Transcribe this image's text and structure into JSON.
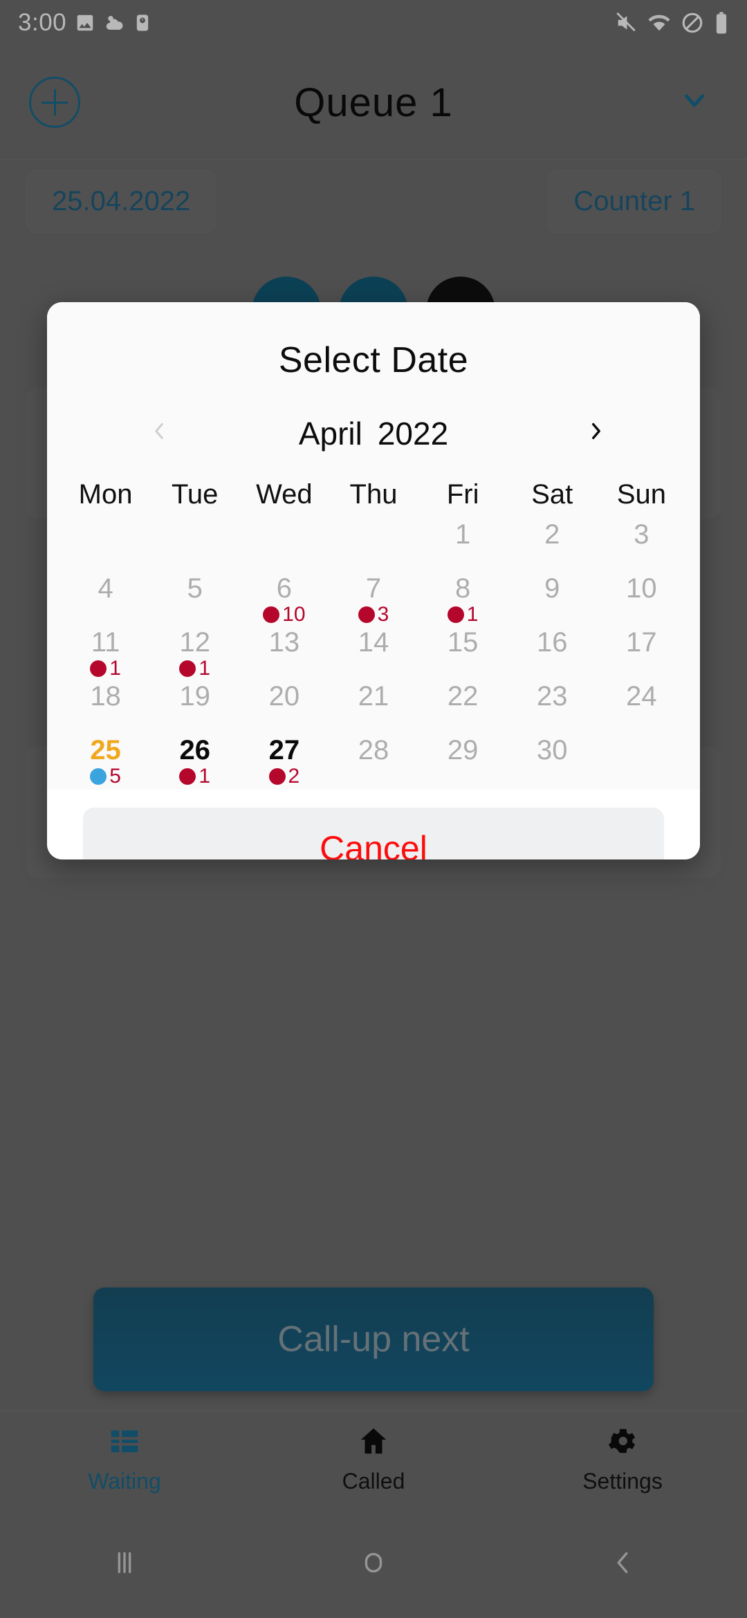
{
  "status_bar": {
    "time": "3:00",
    "left_icons": [
      "image-icon",
      "weather-icon",
      "alarm-clock-icon"
    ],
    "right_icons": [
      "mute-icon",
      "wifi-icon",
      "do-not-disturb-icon",
      "battery-icon"
    ]
  },
  "app_bar": {
    "add_icon": "plus-circle-icon",
    "title": "Queue 1",
    "dropdown_icon": "chevron-down-icon",
    "accent_color": "#1a6b8f"
  },
  "filters": {
    "date_chip": "25.04.2022",
    "counter_chip": "Counter 1"
  },
  "primary_action": {
    "label": "Call-up next"
  },
  "bottom_nav": {
    "items": [
      {
        "label": "Waiting",
        "icon": "list-icon",
        "active": true
      },
      {
        "label": "Called",
        "icon": "home-icon",
        "active": false
      },
      {
        "label": "Settings",
        "icon": "gear-icon",
        "active": false
      }
    ]
  },
  "system_nav": {
    "recents_icon": "recents-icon",
    "home_icon": "home-circle-icon",
    "back_icon": "back-chevron-icon"
  },
  "dialog": {
    "title": "Select Date",
    "prev_icon": "chevron-left-icon",
    "next_icon": "chevron-right-icon",
    "prev_enabled": false,
    "next_enabled": true,
    "month": "April",
    "year": "2022",
    "weekdays": [
      "Mon",
      "Tue",
      "Wed",
      "Thu",
      "Fri",
      "Sat",
      "Sun"
    ],
    "cancel_label": "Cancel",
    "colors": {
      "selected_day": "#f0a81e",
      "badge_red": "#b5062c",
      "badge_blue": "#3ba3de",
      "cancel_text": "#fc0d0d"
    },
    "weeks": [
      [
        {
          "day": "",
          "state": "blank",
          "badge": null
        },
        {
          "day": "",
          "state": "blank",
          "badge": null
        },
        {
          "day": "",
          "state": "blank",
          "badge": null
        },
        {
          "day": "",
          "state": "blank",
          "badge": null
        },
        {
          "day": "1",
          "state": "normal",
          "badge": null
        },
        {
          "day": "2",
          "state": "normal",
          "badge": null
        },
        {
          "day": "3",
          "state": "normal",
          "badge": null
        }
      ],
      [
        {
          "day": "4",
          "state": "normal",
          "badge": null
        },
        {
          "day": "5",
          "state": "normal",
          "badge": null
        },
        {
          "day": "6",
          "state": "normal",
          "badge": {
            "count": "10",
            "color": "red"
          }
        },
        {
          "day": "7",
          "state": "normal",
          "badge": {
            "count": "3",
            "color": "red"
          }
        },
        {
          "day": "8",
          "state": "normal",
          "badge": {
            "count": "1",
            "color": "red"
          }
        },
        {
          "day": "9",
          "state": "normal",
          "badge": null
        },
        {
          "day": "10",
          "state": "normal",
          "badge": null
        }
      ],
      [
        {
          "day": "11",
          "state": "normal",
          "badge": {
            "count": "1",
            "color": "red"
          }
        },
        {
          "day": "12",
          "state": "normal",
          "badge": {
            "count": "1",
            "color": "red"
          }
        },
        {
          "day": "13",
          "state": "normal",
          "badge": null
        },
        {
          "day": "14",
          "state": "normal",
          "badge": null
        },
        {
          "day": "15",
          "state": "normal",
          "badge": null
        },
        {
          "day": "16",
          "state": "normal",
          "badge": null
        },
        {
          "day": "17",
          "state": "normal",
          "badge": null
        }
      ],
      [
        {
          "day": "18",
          "state": "normal",
          "badge": null
        },
        {
          "day": "19",
          "state": "normal",
          "badge": null
        },
        {
          "day": "20",
          "state": "normal",
          "badge": null
        },
        {
          "day": "21",
          "state": "normal",
          "badge": null
        },
        {
          "day": "22",
          "state": "normal",
          "badge": null
        },
        {
          "day": "23",
          "state": "normal",
          "badge": null
        },
        {
          "day": "24",
          "state": "normal",
          "badge": null
        }
      ],
      [
        {
          "day": "25",
          "state": "current",
          "badge": {
            "count": "5",
            "color": "blue"
          }
        },
        {
          "day": "26",
          "state": "emphasis",
          "badge": {
            "count": "1",
            "color": "red"
          }
        },
        {
          "day": "27",
          "state": "emphasis",
          "badge": {
            "count": "2",
            "color": "red"
          }
        },
        {
          "day": "28",
          "state": "normal",
          "badge": null
        },
        {
          "day": "29",
          "state": "normal",
          "badge": null
        },
        {
          "day": "30",
          "state": "normal",
          "badge": null
        },
        {
          "day": "",
          "state": "blank",
          "badge": null
        }
      ]
    ]
  }
}
